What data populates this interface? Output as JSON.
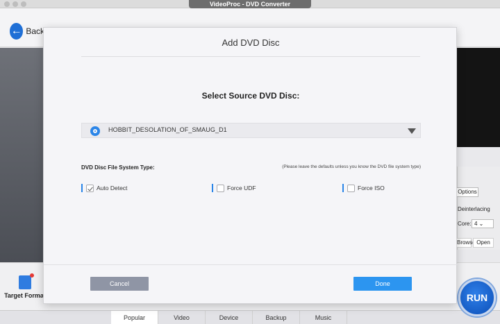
{
  "window": {
    "title": "VideoProc - DVD Converter"
  },
  "toolbar": {
    "back_label": "Back"
  },
  "right_panel": {
    "options_label": "Options",
    "deinterlacing_label": "Deinterlacing",
    "core_label": "Core:",
    "core_value": "4",
    "browse_label": "Browse",
    "open_label": "Open"
  },
  "bottom": {
    "target_format_label": "Target Format",
    "run_label": "RUN",
    "tabs": [
      "Popular",
      "Video",
      "Device",
      "Backup",
      "Music"
    ],
    "active_tab": "Popular"
  },
  "dialog": {
    "title": "Add DVD Disc",
    "heading": "Select Source DVD Disc:",
    "selected_disc": "HOBBIT_DESOLATION_OF_SMAUG_D1",
    "fs_label": "DVD Disc File System Type:",
    "fs_note": "(Please leave the defaults unless you know the DVD file system type)",
    "options": [
      {
        "label": "Auto Detect",
        "checked": true
      },
      {
        "label": "Force UDF",
        "checked": false
      },
      {
        "label": "Force ISO",
        "checked": false
      }
    ],
    "cancel_label": "Cancel",
    "done_label": "Done"
  },
  "colors": {
    "accent": "#2c95f0",
    "cancel": "#8f95a5",
    "run": "#1558c4"
  },
  "icons": [
    "back-arrow-icon",
    "disc-icon",
    "dropdown-arrow-icon",
    "checkbox-icon",
    "target-format-icon"
  ]
}
